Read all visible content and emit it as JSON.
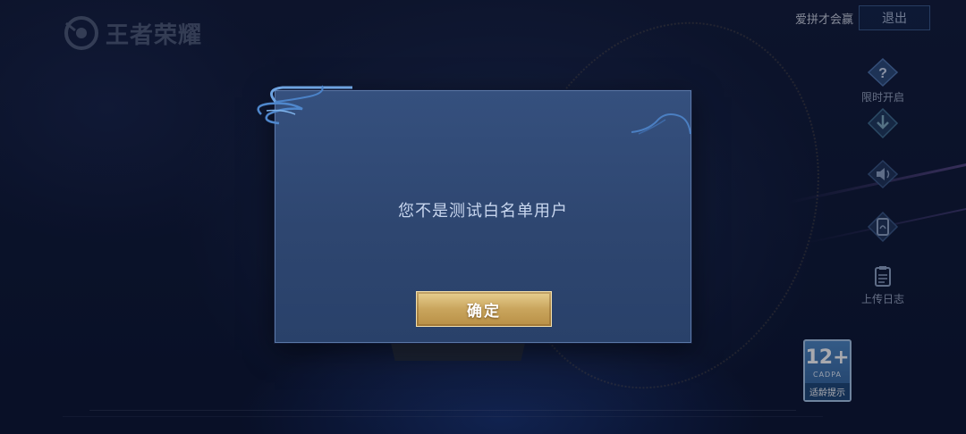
{
  "header": {
    "logo_text": "王者荣耀",
    "user_name": "爱拼才会赢",
    "exit_label": "退出"
  },
  "side_menu": {
    "items": [
      {
        "label": "限时开启",
        "icon": "question-icon"
      },
      {
        "label": "",
        "icon": "download-icon"
      },
      {
        "label": "",
        "icon": "speaker-icon"
      },
      {
        "label": "",
        "icon": "card-icon"
      },
      {
        "label": "上传日志",
        "icon": "clipboard-icon"
      }
    ]
  },
  "age_rating": {
    "number": "12+",
    "org": "CADPA",
    "tip": "适龄提示"
  },
  "dialog": {
    "message": "您不是测试白名单用户",
    "confirm_label": "确定"
  },
  "colors": {
    "dialog_bg": "#2e4670",
    "confirm_gold": "#c9a55d",
    "message_text": "#c8d6ee"
  }
}
